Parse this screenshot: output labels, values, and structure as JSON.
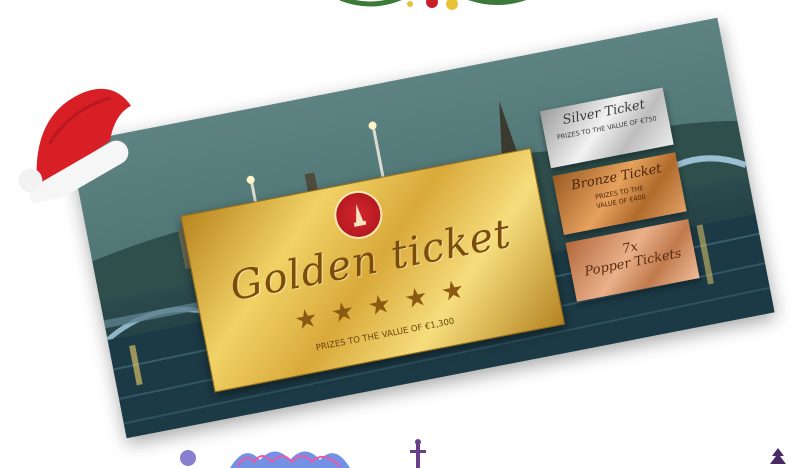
{
  "banner": {
    "golden_ticket": {
      "title": "Golden ticket",
      "star_count": 5,
      "prize_text": "PRIZES TO THE VALUE OF €1,300"
    },
    "silver_ticket": {
      "title": "Silver Ticket",
      "prize_text": "PRIZES TO THE VALUE OF €750"
    },
    "bronze_ticket": {
      "title": "Bronze Ticket",
      "prize_text_line1": "PRIZES TO THE",
      "prize_text_line2": "VALUE OF €400"
    },
    "popper_tickets": {
      "count_text": "7x",
      "title": "Popper Tickets"
    }
  },
  "colors": {
    "gold": "#e7c052",
    "silver": "#d9d9d9",
    "bronze": "#c9803f",
    "copper": "#d89a70",
    "hat_red": "#d81f26"
  },
  "icons": [
    "santa-hat-icon",
    "lighthouse-logo-icon",
    "star-icon",
    "garland-icon",
    "ornament-icon"
  ]
}
